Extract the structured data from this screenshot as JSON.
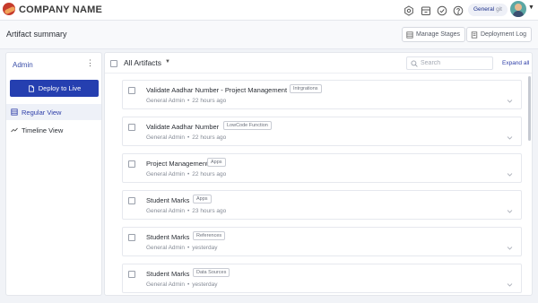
{
  "app": {
    "company_name": "COMPANY NAME",
    "workspace": "General",
    "workspace_sub": "git"
  },
  "page": {
    "title": "Artifact summary",
    "manage_stages_label": "Manage Stages",
    "deployment_log_label": "Deployment Log"
  },
  "sidebar": {
    "title": "Admin",
    "deploy_label": "Deploy to Live",
    "views": [
      {
        "label": "Regular View",
        "active": true
      },
      {
        "label": "Timeline View",
        "active": false
      }
    ]
  },
  "list": {
    "filter_label": "All Artifacts",
    "search_placeholder": "Search",
    "expand_all_label": "Expand all",
    "items": [
      {
        "title": "Validate Aadhar Number - Project Management",
        "tag": "Intrgrations",
        "author": "General Admin",
        "time": "22 hours ago"
      },
      {
        "title": "Validate Aadhar Number",
        "tag": "LowCode Function",
        "author": "General Admin",
        "time": "22 hours ago"
      },
      {
        "title": "Project Management",
        "tag": "Apps",
        "author": "General Admin",
        "time": "22 hours ago"
      },
      {
        "title": "Student Marks",
        "tag": "Apps",
        "author": "General Admin",
        "time": "23 hours ago"
      },
      {
        "title": "Student Marks",
        "tag": "References",
        "author": "General Admin",
        "time": "yesterday"
      },
      {
        "title": "Student Marks",
        "tag": "Data Sources",
        "author": "General Admin",
        "time": "yesterday"
      }
    ]
  },
  "colors": {
    "primary": "#253fb0",
    "link": "#2e3ea8",
    "logo": "#c63b2c"
  }
}
